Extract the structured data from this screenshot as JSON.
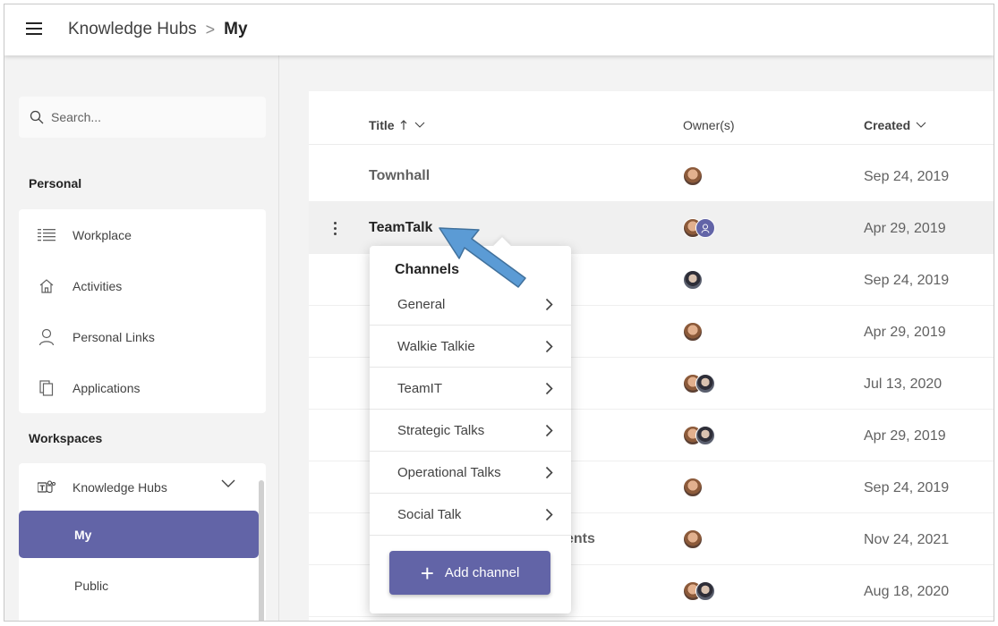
{
  "breadcrumb": {
    "root": "Knowledge Hubs",
    "separator": ">",
    "current": "My"
  },
  "search": {
    "placeholder": "Search..."
  },
  "sidebar": {
    "personal_title": "Personal",
    "personal_items": [
      {
        "label": "Workplace",
        "icon": "grid-list-icon"
      },
      {
        "label": "Activities",
        "icon": "home-icon"
      },
      {
        "label": "Personal Links",
        "icon": "person-icon"
      },
      {
        "label": "Applications",
        "icon": "copy-icon"
      }
    ],
    "workspaces_title": "Workspaces",
    "workspace": {
      "label": "Knowledge Hubs",
      "icon": "teams-icon"
    },
    "workspace_children": [
      "My",
      "Public"
    ]
  },
  "table": {
    "headers": {
      "title": "Title",
      "owners": "Owner(s)",
      "created": "Created"
    },
    "rows": [
      {
        "title": "Townhall",
        "created": "Sep 24, 2019"
      },
      {
        "title": "TeamTalk",
        "created": "Apr 29, 2019"
      },
      {
        "title": "",
        "created": "Sep 24, 2019"
      },
      {
        "title": "",
        "created": "Apr 29, 2019"
      },
      {
        "title": "",
        "created": "Jul 13, 2020"
      },
      {
        "title": "",
        "created": "Apr 29, 2019"
      },
      {
        "title": "",
        "created": "Sep 24, 2019"
      },
      {
        "title": "",
        "partial": "ents",
        "created": "Nov 24, 2021"
      },
      {
        "title": "",
        "created": "Aug 18, 2020"
      }
    ]
  },
  "channels": {
    "title": "Channels",
    "items": [
      "General",
      "Walkie Talkie",
      "TeamIT",
      "Strategic Talks",
      "Operational Talks",
      "Social Talk"
    ],
    "add_label": "Add channel"
  },
  "colors": {
    "accent": "#6264a7",
    "arrow": "#5b9bd5"
  }
}
